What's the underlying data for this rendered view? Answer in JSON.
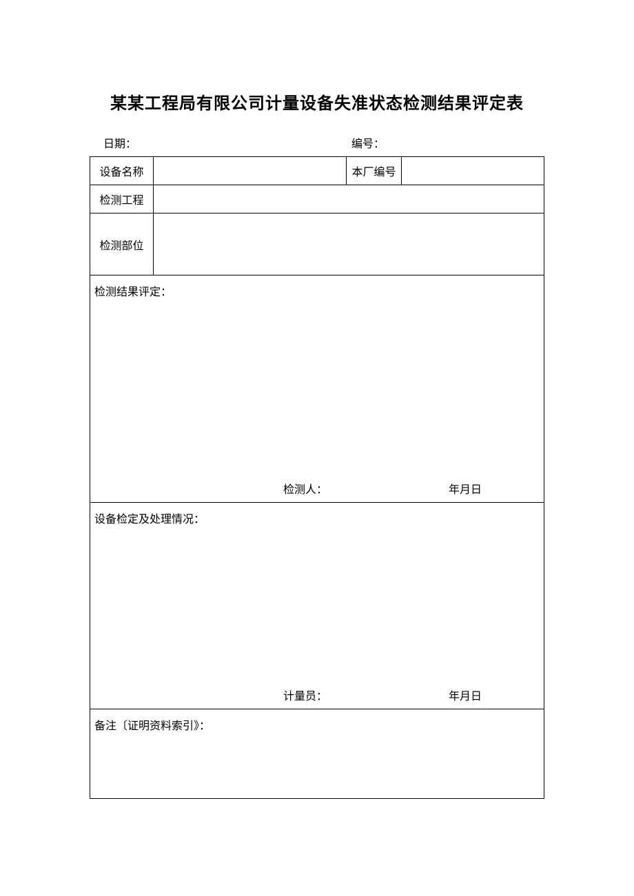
{
  "title": "某某工程局有限公司计量设备失准状态检测结果评定表",
  "header": {
    "date_label": "日期：",
    "serial_label": "编号："
  },
  "rows": {
    "device_name_label": "设备名称",
    "factory_number_label": "本厂编号",
    "detect_project_label": "检测工程",
    "detect_part_label": "检测部位"
  },
  "result": {
    "label": "检测结果评定：",
    "inspector_label": "检测人：",
    "date_label": "年月日"
  },
  "processing": {
    "label": "设备检定及处理情况：",
    "metrologist_label": "计量员：",
    "date_label": "年月日"
  },
  "remark": {
    "label": "备注〔证明资料索引》："
  }
}
